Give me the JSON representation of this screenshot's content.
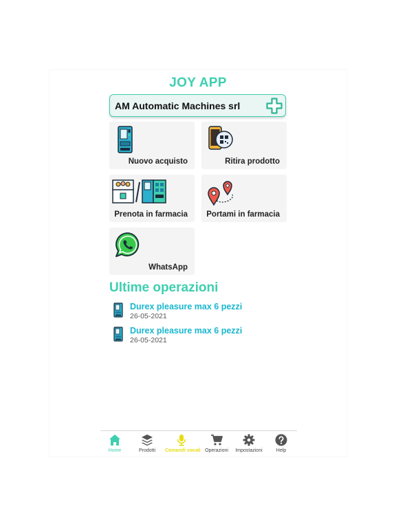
{
  "app": {
    "title": "JOY APP"
  },
  "machine": {
    "name": "AM Automatic Machines srl",
    "icon": "pharmacy-cross-icon"
  },
  "tiles": [
    {
      "label": "Nuovo acquisto",
      "icon": "vending-machine-icon"
    },
    {
      "label": "Ritira prodotto",
      "icon": "phone-qr-code-icon"
    },
    {
      "label": "Prenota in farmacia",
      "icon": "pharmacy-booking-icon"
    },
    {
      "label": "Portami in farmacia",
      "icon": "map-route-icon"
    },
    {
      "label": "WhatsApp",
      "icon": "whatsapp-icon"
    }
  ],
  "recent": {
    "title": "Ultime operazioni",
    "items": [
      {
        "name": "Durex pleasure max 6 pezzi",
        "date": "26-05-2021",
        "icon": "vending-machine-icon"
      },
      {
        "name": "Durex pleasure max 6 pezzi",
        "date": "26-05-2021",
        "icon": "vending-machine-icon"
      }
    ]
  },
  "nav": {
    "items": [
      {
        "label": "Home",
        "icon": "home-icon"
      },
      {
        "label": "Prodotti",
        "icon": "layers-icon"
      },
      {
        "label": "Comandi vocali",
        "icon": "microphone-icon"
      },
      {
        "label": "Operazioni",
        "icon": "cart-icon"
      },
      {
        "label": "Impostazioni",
        "icon": "gear-icon"
      },
      {
        "label": "Help",
        "icon": "help-icon"
      }
    ]
  },
  "colors": {
    "accent": "#3ecfb0",
    "link": "#19b7cf",
    "voice": "#e8dc14",
    "tile": "#f4f4f4"
  }
}
